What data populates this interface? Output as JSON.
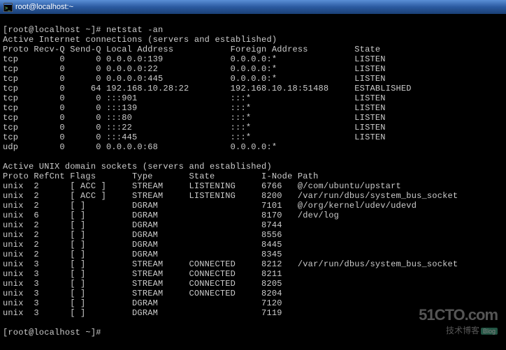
{
  "window": {
    "title": "root@localhost:~"
  },
  "prompt1": "[root@localhost ~]# ",
  "command": "netstat -an",
  "header_inet": "Active Internet connections (servers and established)",
  "cols_inet": "Proto Recv-Q Send-Q Local Address           Foreign Address         State",
  "inet_rows": [
    "tcp        0      0 0.0.0.0:139             0.0.0.0:*               LISTEN",
    "tcp        0      0 0.0.0.0:22              0.0.0.0:*               LISTEN",
    "tcp        0      0 0.0.0.0:445             0.0.0.0:*               LISTEN",
    "tcp        0     64 192.168.10.28:22        192.168.10.18:51488     ESTABLISHED",
    "tcp        0      0 :::901                  :::*                    LISTEN",
    "tcp        0      0 :::139                  :::*                    LISTEN",
    "tcp        0      0 :::80                   :::*                    LISTEN",
    "tcp        0      0 :::22                   :::*                    LISTEN",
    "tcp        0      0 :::445                  :::*                    LISTEN",
    "udp        0      0 0.0.0.0:68              0.0.0.0:*"
  ],
  "header_unix": "Active UNIX domain sockets (servers and established)",
  "cols_unix": "Proto RefCnt Flags       Type       State         I-Node Path",
  "unix_rows": [
    "unix  2      [ ACC ]     STREAM     LISTENING     6766   @/com/ubuntu/upstart",
    "unix  2      [ ACC ]     STREAM     LISTENING     8200   /var/run/dbus/system_bus_socket",
    "unix  2      [ ]         DGRAM                    7101   @/org/kernel/udev/udevd",
    "unix  6      [ ]         DGRAM                    8170   /dev/log",
    "unix  2      [ ]         DGRAM                    8744",
    "unix  2      [ ]         DGRAM                    8556",
    "unix  2      [ ]         DGRAM                    8445",
    "unix  2      [ ]         DGRAM                    8345",
    "unix  3      [ ]         STREAM     CONNECTED     8212   /var/run/dbus/system_bus_socket",
    "unix  3      [ ]         STREAM     CONNECTED     8211",
    "unix  3      [ ]         STREAM     CONNECTED     8205",
    "unix  3      [ ]         STREAM     CONNECTED     8204",
    "unix  3      [ ]         DGRAM                    7120",
    "unix  3      [ ]         DGRAM                    7119"
  ],
  "prompt2": "[root@localhost ~]#",
  "watermark": {
    "line1": "51CTO.com",
    "line2": "技术博客",
    "badge": "Blog"
  }
}
